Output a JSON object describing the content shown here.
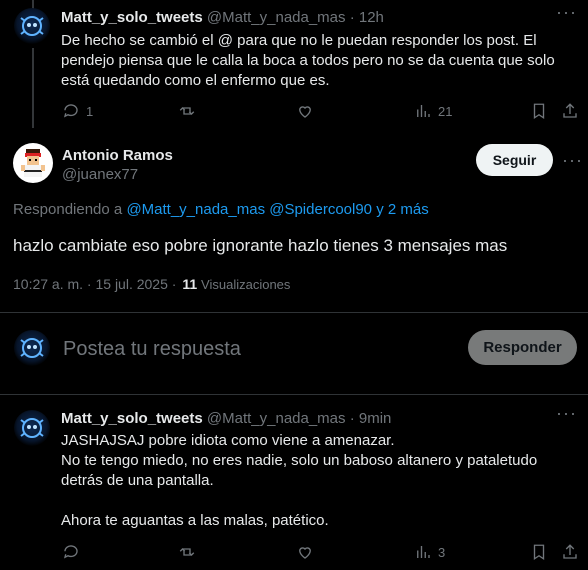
{
  "tweet1": {
    "display_name": "Matt_y_solo_tweets",
    "handle": "@Matt_y_nada_mas",
    "sep": "·",
    "time": "12h",
    "text_lines": [
      "De hecho se cambió el @ para que no le puedan responder los post. El",
      "pendejo piensa que le calla la boca a todos pero no se da cuenta que solo",
      "está quedando como el enfermo que es."
    ],
    "reply_count": "1",
    "views_count": "21"
  },
  "main_tweet": {
    "display_name": "Antonio Ramos",
    "handle": "@juanex77",
    "follow_label": "Seguir",
    "replying_prefix": "Respondiendo a",
    "replying_handles": "@Matt_y_nada_mas @Spidercool90 y 2 más",
    "text": "hazlo cambiate eso pobre ignorante hazlo tienes 3 mensajes mas",
    "timestamp": "10:27 a. m. · 15 jul. 2025 ·",
    "views_number": "11",
    "views_label": "Visualizaciones"
  },
  "composer": {
    "placeholder": "Postea tu respuesta",
    "reply_label": "Responder"
  },
  "tweet3": {
    "display_name": "Matt_y_solo_tweets",
    "handle": "@Matt_y_nada_mas",
    "sep": "·",
    "time": "9min",
    "text_lines": [
      "JASHAJSAJ pobre idiota como viene a amenazar.",
      "No te tengo miedo, no eres nadie, solo un baboso altanero y pataletudo",
      "detrás de una pantalla.",
      "",
      "Ahora te aguantas a las malas, patético."
    ],
    "views_count": "3"
  },
  "colors": {
    "accent": "#1d9bf0",
    "muted": "#71767b",
    "divider": "#2f3336"
  }
}
